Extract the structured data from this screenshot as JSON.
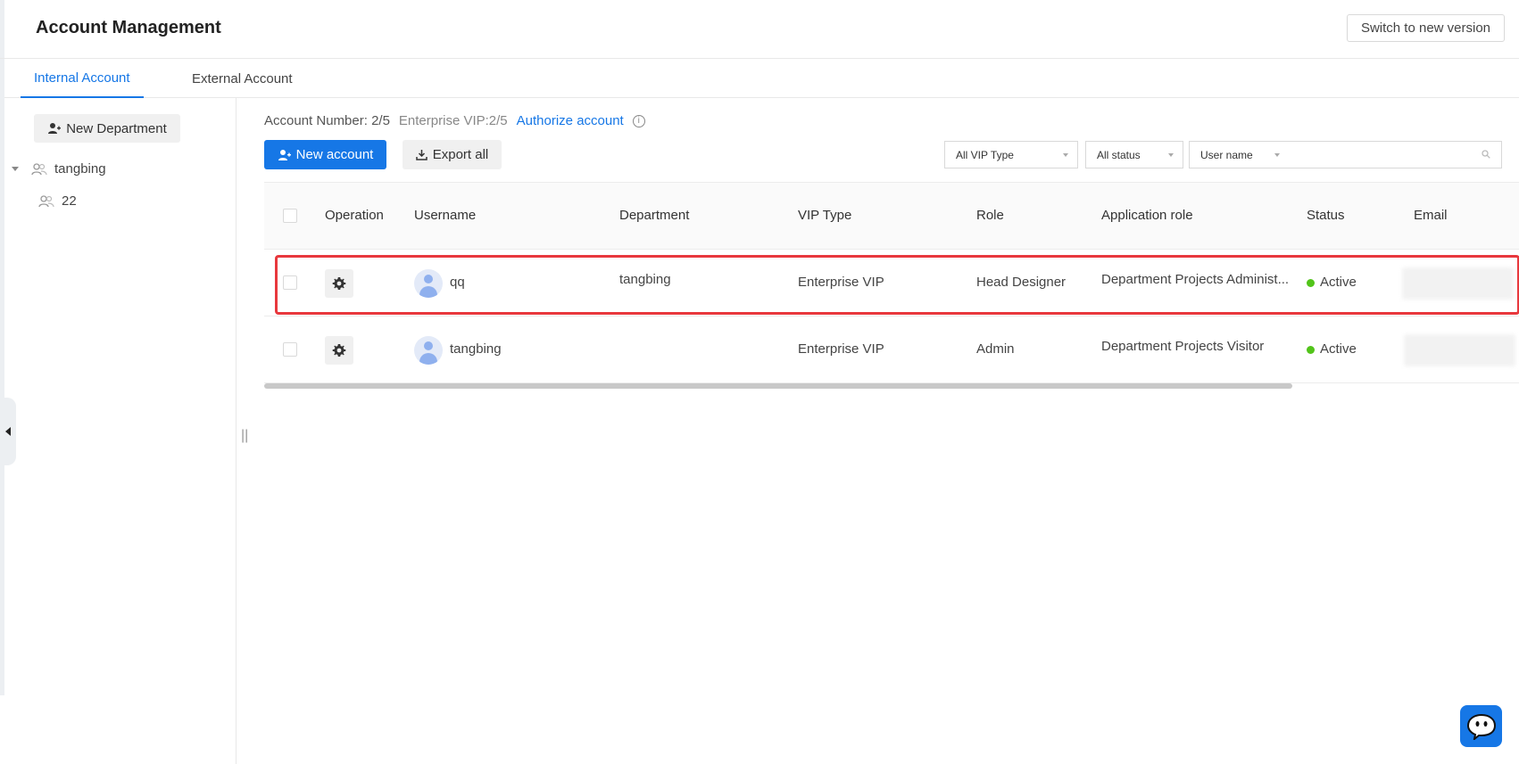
{
  "header": {
    "title": "Account Management",
    "switch_label": "Switch to new version"
  },
  "tabs": [
    {
      "label": "Internal Account",
      "active": true
    },
    {
      "label": "External Account",
      "active": false
    }
  ],
  "sidebar": {
    "new_department_label": "New Department",
    "tree": [
      {
        "label": "tangbing",
        "expanded": true,
        "icon": "group-icon"
      },
      {
        "label": "22",
        "icon": "group-icon"
      }
    ]
  },
  "summary": {
    "account_number_label": "Account Number:",
    "account_number_value": "2/5",
    "enterprise_vip": "Enterprise VIP:2/5",
    "authorize_label": "Authorize account"
  },
  "toolbar": {
    "new_account_label": "New account",
    "export_label": "Export all"
  },
  "filters": {
    "vip_type": "All VIP Type",
    "status": "All status",
    "search_field": "User name",
    "search_value": ""
  },
  "table": {
    "columns": [
      "Operation",
      "Username",
      "Department",
      "VIP Type",
      "Role",
      "Application role",
      "Status",
      "Email"
    ],
    "rows": [
      {
        "username": "qq",
        "department": "tangbing",
        "vip_type": "Enterprise VIP",
        "role": "Head Designer",
        "application_role": "Department Projects Administ...",
        "status": "Active",
        "highlighted": true
      },
      {
        "username": "tangbing",
        "department": "",
        "vip_type": "Enterprise VIP",
        "role": "Admin",
        "application_role": "Department Projects Visitor",
        "status": "Active",
        "highlighted": false
      }
    ]
  },
  "colors": {
    "accent": "#1677e6",
    "active_status": "#52c41a",
    "highlight_border": "#e8383d"
  }
}
